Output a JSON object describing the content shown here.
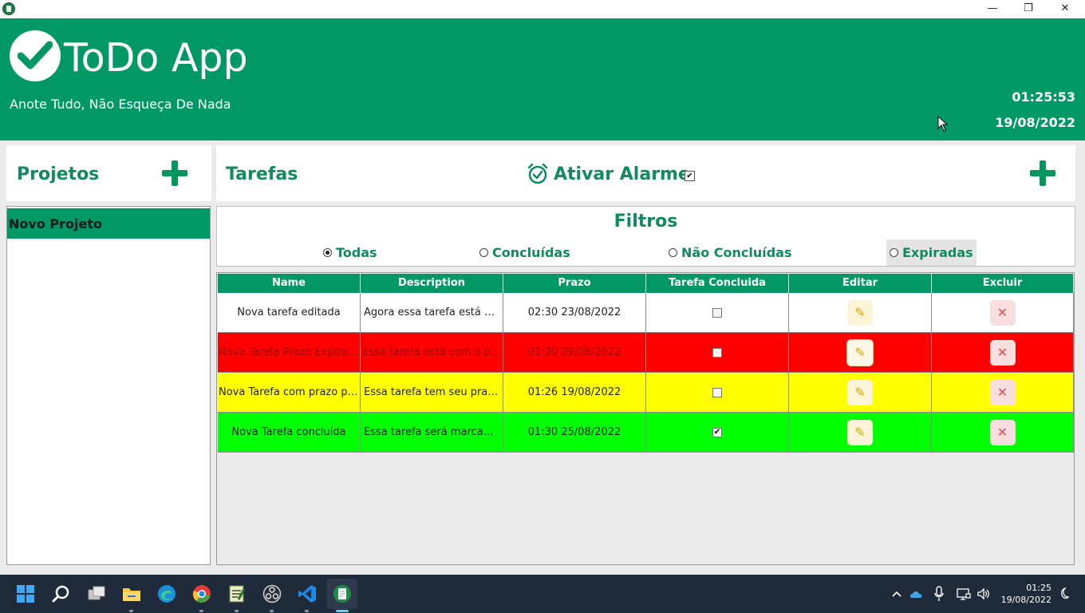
{
  "window": {
    "minimize": "—",
    "maximize": "❐",
    "close": "✕"
  },
  "header": {
    "title": "ToDo App",
    "subtitle": "Anote Tudo, Não Esqueça De Nada",
    "time": "01:25:53",
    "date": "19/08/2022"
  },
  "projects": {
    "title": "Projetos",
    "items": [
      {
        "label": "Novo Projeto",
        "selected": true
      }
    ]
  },
  "tasks": {
    "title": "Tarefas",
    "alarm_label": "Ativar Alarme",
    "alarm_checked": true
  },
  "filters": {
    "title": "Filtros",
    "options": [
      {
        "label": "Todas",
        "selected": true
      },
      {
        "label": "Concluídas",
        "selected": false
      },
      {
        "label": "Não Concluídas",
        "selected": false
      },
      {
        "label": "Expiradas",
        "selected": false
      }
    ]
  },
  "table": {
    "columns": [
      "Name",
      "Description",
      "Prazo",
      "Tarefa Concluida",
      "Editar",
      "Excluir"
    ],
    "rows": [
      {
        "name": "Nova tarefa editada",
        "description": "Agora essa tarefa está sen...",
        "prazo": "02:30 23/08/2022",
        "done": false,
        "status": "normal"
      },
      {
        "name": "Nova Tarefa Prazo Expirado",
        "description": "Essa tarefa está com o praz...",
        "prazo": "01:30 09/08/2022",
        "done": false,
        "status": "expired"
      },
      {
        "name": "Nova Tarefa com prazo par...",
        "description": "Essa tarefa tem seu prazo ...",
        "prazo": "01:26 19/08/2022",
        "done": false,
        "status": "due-today"
      },
      {
        "name": "Nova Tarefa concluída",
        "description": "Essa tarefa será marcada c...",
        "prazo": "01:30 25/08/2022",
        "done": true,
        "status": "done"
      }
    ]
  },
  "colors": {
    "brand_green": "#009865",
    "text_green": "#108a5e",
    "expired": "#ff0000",
    "due_today": "#ffff00",
    "done": "#00ff00"
  },
  "taskbar": {
    "clock_time": "01:25",
    "clock_date": "19/08/2022",
    "apps": [
      "start-icon",
      "search-icon",
      "task-view-icon",
      "file-explorer-icon",
      "edge-icon",
      "chrome-icon",
      "notepad-icon",
      "obs-icon",
      "vscode-icon",
      "todo-app-icon"
    ]
  }
}
